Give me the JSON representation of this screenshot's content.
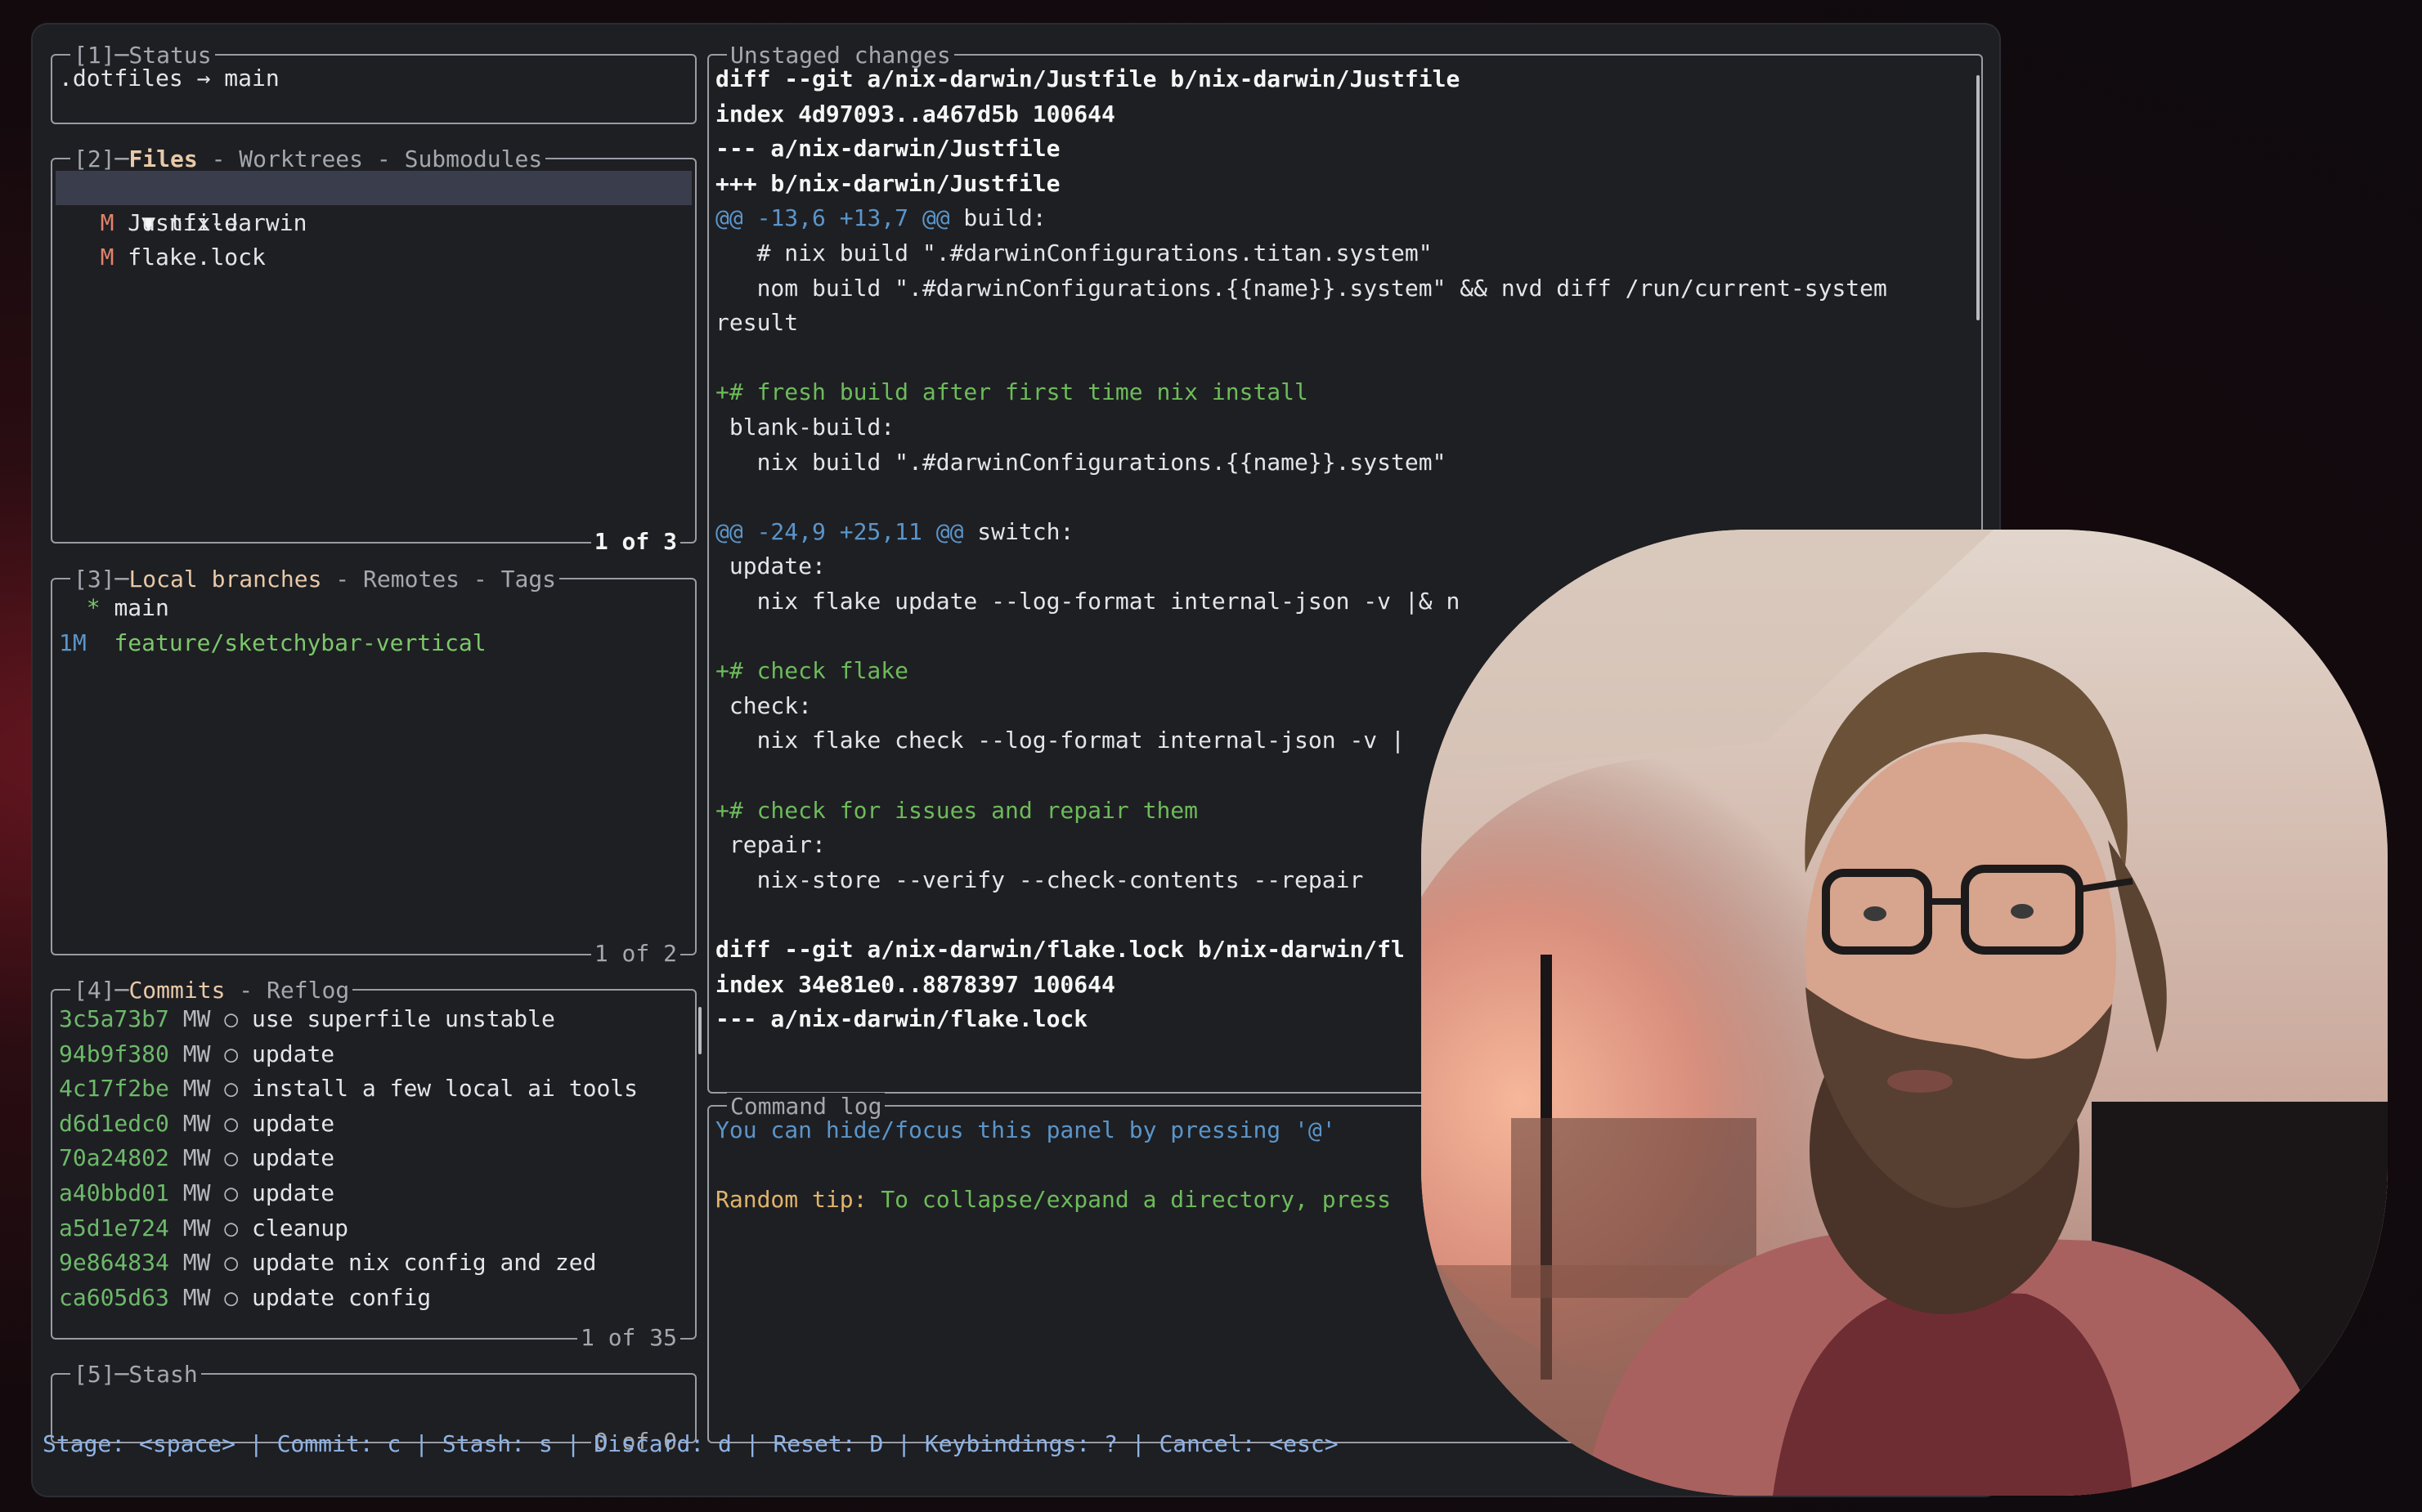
{
  "status_panel": {
    "title": "[1]─Status",
    "content": ".dotfiles → main"
  },
  "files_panel": {
    "title_num": "[2]─",
    "title_active": "Files",
    "title_rest": " - Worktrees - Submodules",
    "items": [
      {
        "glyph": "▼",
        "name": "nix-darwin",
        "selected": true
      },
      {
        "glyph": "M",
        "name": "Justfile"
      },
      {
        "glyph": "M",
        "name": "flake.lock"
      }
    ],
    "count": "1 of 3"
  },
  "branches_panel": {
    "title_num": "[3]─",
    "title_active": "Local branches",
    "title_rest": " - Remotes - Tags",
    "items": [
      {
        "marker": "  *",
        "name": "main"
      },
      {
        "marker": "1M ",
        "name": "feature/sketchybar-vertical"
      }
    ],
    "count": "1 of 2"
  },
  "commits_panel": {
    "title_num": "[4]─",
    "title_active": "Commits",
    "title_rest": " - Reflog",
    "items": [
      {
        "hash": "3c5a73b7",
        "author": "MW",
        "msg": "use superfile unstable"
      },
      {
        "hash": "94b9f380",
        "author": "MW",
        "msg": "update"
      },
      {
        "hash": "4c17f2be",
        "author": "MW",
        "msg": "install a few local ai tools"
      },
      {
        "hash": "d6d1edc0",
        "author": "MW",
        "msg": "update"
      },
      {
        "hash": "70a24802",
        "author": "MW",
        "msg": "update"
      },
      {
        "hash": "a40bbd01",
        "author": "MW",
        "msg": "update"
      },
      {
        "hash": "a5d1e724",
        "author": "MW",
        "msg": "cleanup"
      },
      {
        "hash": "9e864834",
        "author": "MW",
        "msg": "update nix config and zed"
      },
      {
        "hash": "ca605d63",
        "author": "MW",
        "msg": "update config"
      }
    ],
    "count": "1 of 35"
  },
  "stash_panel": {
    "title": "[5]─Stash",
    "count": "0 of 0"
  },
  "diff_panel": {
    "title": "Unstaged changes",
    "lines": [
      {
        "t": "bold",
        "s": "diff --git a/nix-darwin/Justfile b/nix-darwin/Justfile"
      },
      {
        "t": "bold",
        "s": "index 4d97093..a467d5b 100644"
      },
      {
        "t": "bold",
        "s": "--- a/nix-darwin/Justfile"
      },
      {
        "t": "bold",
        "s": "+++ b/nix-darwin/Justfile"
      },
      {
        "t": "hunk",
        "s": "@@ -13,6 +13,7 @@",
        "rest": " build:"
      },
      {
        "t": "ctx",
        "s": "   # nix build \".#darwinConfigurations.titan.system\""
      },
      {
        "t": "ctx",
        "s": "   nom build \".#darwinConfigurations.{{name}}.system\" && nvd diff /run/current-system"
      },
      {
        "t": "ctx",
        "s": "result"
      },
      {
        "t": "ctx",
        "s": ""
      },
      {
        "t": "add",
        "s": "+# fresh build after first time nix install"
      },
      {
        "t": "ctx",
        "s": " blank-build:"
      },
      {
        "t": "ctx",
        "s": "   nix build \".#darwinConfigurations.{{name}}.system\""
      },
      {
        "t": "ctx",
        "s": ""
      },
      {
        "t": "hunk",
        "s": "@@ -24,9 +25,11 @@",
        "rest": " switch:"
      },
      {
        "t": "ctx",
        "s": " update:"
      },
      {
        "t": "ctx",
        "s": "   nix flake update --log-format internal-json -v |& n"
      },
      {
        "t": "ctx",
        "s": ""
      },
      {
        "t": "add",
        "s": "+# check flake"
      },
      {
        "t": "ctx",
        "s": " check:"
      },
      {
        "t": "ctx",
        "s": "   nix flake check --log-format internal-json -v |"
      },
      {
        "t": "ctx",
        "s": ""
      },
      {
        "t": "add",
        "s": "+# check for issues and repair them"
      },
      {
        "t": "ctx",
        "s": " repair:"
      },
      {
        "t": "ctx",
        "s": "   nix-store --verify --check-contents --repair"
      },
      {
        "t": "ctx",
        "s": ""
      },
      {
        "t": "bold",
        "s": "diff --git a/nix-darwin/flake.lock b/nix-darwin/fl"
      },
      {
        "t": "bold",
        "s": "index 34e81e0..8878397 100644"
      },
      {
        "t": "bold",
        "s": "--- a/nix-darwin/flake.lock"
      }
    ]
  },
  "command_log": {
    "title": "Command log",
    "hint": "You can hide/focus this panel by pressing '@'",
    "tip_label": "Random tip:",
    "tip_text": " To collapse/expand a directory, press"
  },
  "keybar": "Stage: <space> | Commit: c | Stash: s | Discard: d | Reset: D | Keybindings: ? | Cancel: <esc>",
  "colors": {
    "accent_title": "#e8c9a8",
    "hash_green": "#6db96a",
    "diff_add": "#6dbb5a",
    "hunk_blue": "#5b95c9",
    "keybar_blue": "#8fb3e6"
  }
}
